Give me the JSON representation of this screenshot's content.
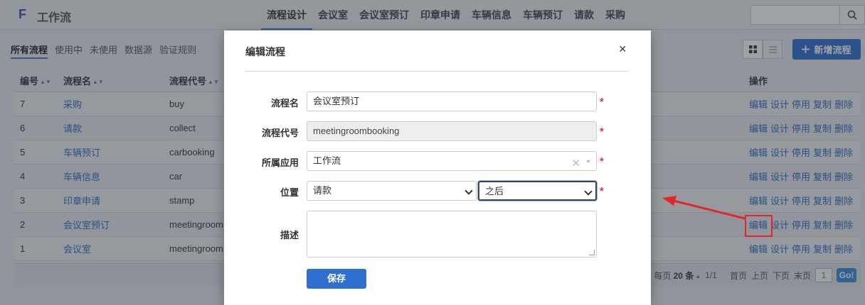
{
  "app": {
    "logo": "F",
    "title": "工作流"
  },
  "nav": {
    "items": [
      {
        "label": "流程设计",
        "active": true
      },
      {
        "label": "会议室"
      },
      {
        "label": "会议室预订"
      },
      {
        "label": "印章申请"
      },
      {
        "label": "车辆信息"
      },
      {
        "label": "车辆预订"
      },
      {
        "label": "请款"
      },
      {
        "label": "采购"
      }
    ]
  },
  "filters": {
    "all": "所有流程",
    "in_use": "使用中",
    "unused": "未使用",
    "datasource": "数据源",
    "validation": "验证规则"
  },
  "toolbar": {
    "add_label": "新增流程",
    "add_icon": "plus-icon"
  },
  "table": {
    "headers": {
      "id": "编号",
      "name": "流程名",
      "code": "流程代号",
      "ops": "操作"
    },
    "op_labels": {
      "edit": "编辑",
      "design": "设计",
      "disable": "停用",
      "copy": "复制",
      "delete": "删除"
    },
    "rows": [
      {
        "id": "7",
        "name": "采购",
        "code": "buy"
      },
      {
        "id": "6",
        "name": "请款",
        "code": "collect"
      },
      {
        "id": "5",
        "name": "车辆预订",
        "code": "carbooking"
      },
      {
        "id": "4",
        "name": "车辆信息",
        "code": "car"
      },
      {
        "id": "3",
        "name": "印章申请",
        "code": "stamp"
      },
      {
        "id": "2",
        "name": "会议室预订",
        "code": "meetingroom"
      },
      {
        "id": "1",
        "name": "会议室",
        "code": "meetingroom"
      }
    ]
  },
  "pager": {
    "per_page_prefix": "每页",
    "per_page": "20",
    "per_page_suffix": "条",
    "pages": "1/1",
    "first": "首页",
    "prev": "上页",
    "next": "下页",
    "last": "末页",
    "page_input": "1",
    "go": "Go!"
  },
  "modal": {
    "title": "编辑流程",
    "close": "×",
    "fields": {
      "name_label": "流程名",
      "name_value": "会议室预订",
      "code_label": "流程代号",
      "code_value": "meetingroombooking",
      "app_label": "所属应用",
      "app_value": "工作流",
      "position_label": "位置",
      "position_value": "请款",
      "position_order": "之后",
      "desc_label": "描述",
      "desc_value": ""
    },
    "required_mark": "*",
    "save": "保存"
  },
  "colors": {
    "primary": "#2f6fd0",
    "link": "#2e6bc4",
    "required": "#e0344a",
    "annotation": "#e0282a"
  }
}
